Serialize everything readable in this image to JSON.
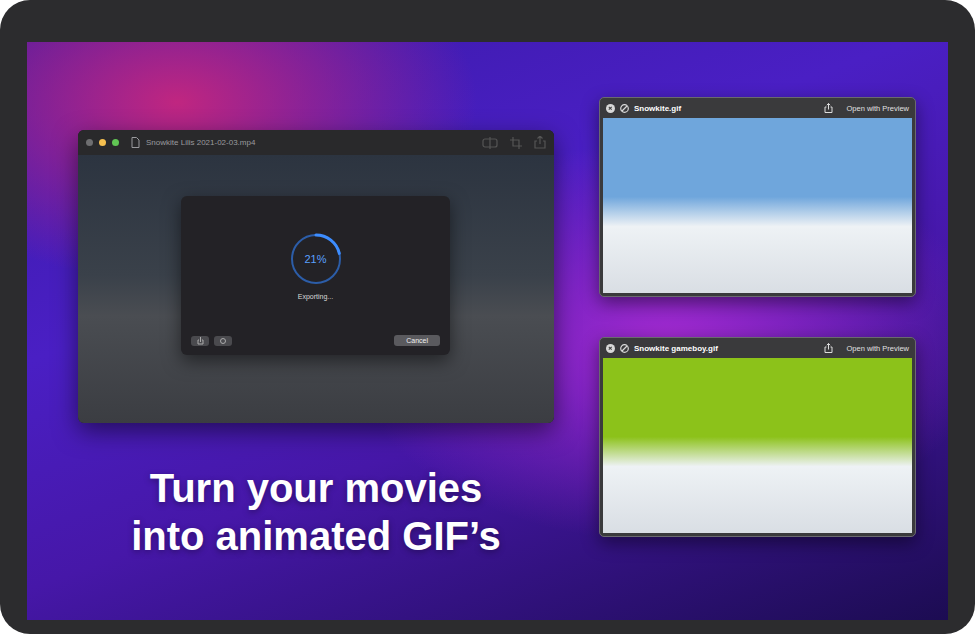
{
  "main_window": {
    "title": "Snowkite Lilis 2021-02-03.mp4"
  },
  "export_dialog": {
    "progress_label": "21%",
    "level": 0.21,
    "status": "Exporting...",
    "buttons": [
      "Cancel"
    ]
  },
  "previews": [
    {
      "title": "Snowkite.gif",
      "action": "Open with Preview",
      "color": "#6fa6dc"
    },
    {
      "title": "Snowkite gameboy.gif",
      "action": "Open with Preview",
      "color": "#8cc21a"
    }
  ],
  "headline": [
    "Turn your movies",
    "into animated GIF’s"
  ]
}
